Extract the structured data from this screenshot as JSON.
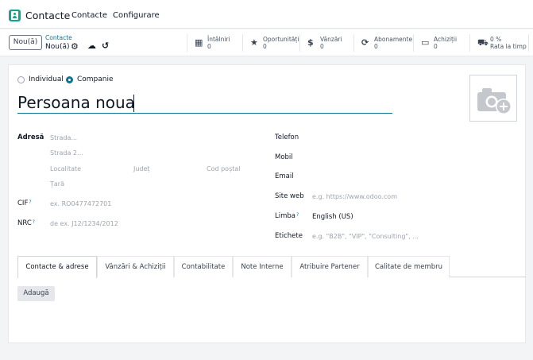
{
  "app": {
    "title": "Contacte",
    "menu": [
      "Contacte",
      "Configurare"
    ]
  },
  "control": {
    "new_label": "Nou(ă)",
    "breadcrumb_parent": "Contacte",
    "breadcrumb_current": "Nou(ă)"
  },
  "smart_buttons": [
    {
      "icon": "calendar-icon",
      "label": "Întâlniri",
      "value": "0"
    },
    {
      "icon": "star-icon",
      "label": "Oportunități",
      "value": "0"
    },
    {
      "icon": "dollar-icon",
      "label": "Vânzări",
      "value": "0"
    },
    {
      "icon": "refresh-icon",
      "label": "Abonamente",
      "value": "0"
    },
    {
      "icon": "credit-card-icon",
      "label": "Achiziții",
      "value": "0"
    },
    {
      "icon": "truck-icon",
      "label": "0 %",
      "value": "Rata la timp"
    }
  ],
  "form": {
    "type_options": [
      "Individual",
      "Companie"
    ],
    "type_selected": "Companie",
    "name_value": "Persoana noua",
    "labels": {
      "address": "Adresă",
      "vat": "CIF",
      "nrc": "NRC",
      "phone": "Telefon",
      "mobile": "Mobil",
      "email": "Email",
      "website": "Site web",
      "language": "Limba",
      "tags": "Etichete"
    },
    "help_marker": "?",
    "placeholders": {
      "street": "Strada...",
      "street2": "Strada 2...",
      "city": "Localitate",
      "state": "Județ",
      "zip": "Cod poștal",
      "country": "Țară",
      "vat": "ex. RO0477472701",
      "nrc": "de ex. J12/1234/2012",
      "website": "e.g. https://www.odoo.com",
      "tags": "e.g. \"B2B\", \"VIP\", \"Consulting\", ..."
    },
    "language_value": "English (US)"
  },
  "tabs": [
    "Contacte & adrese",
    "Vânzări & Achiziții",
    "Contabilitate",
    "Note Interne",
    "Atribuire Partener",
    "Calitate de membru"
  ],
  "active_tab": "Contacte & adrese",
  "add_label": "Adaugă"
}
